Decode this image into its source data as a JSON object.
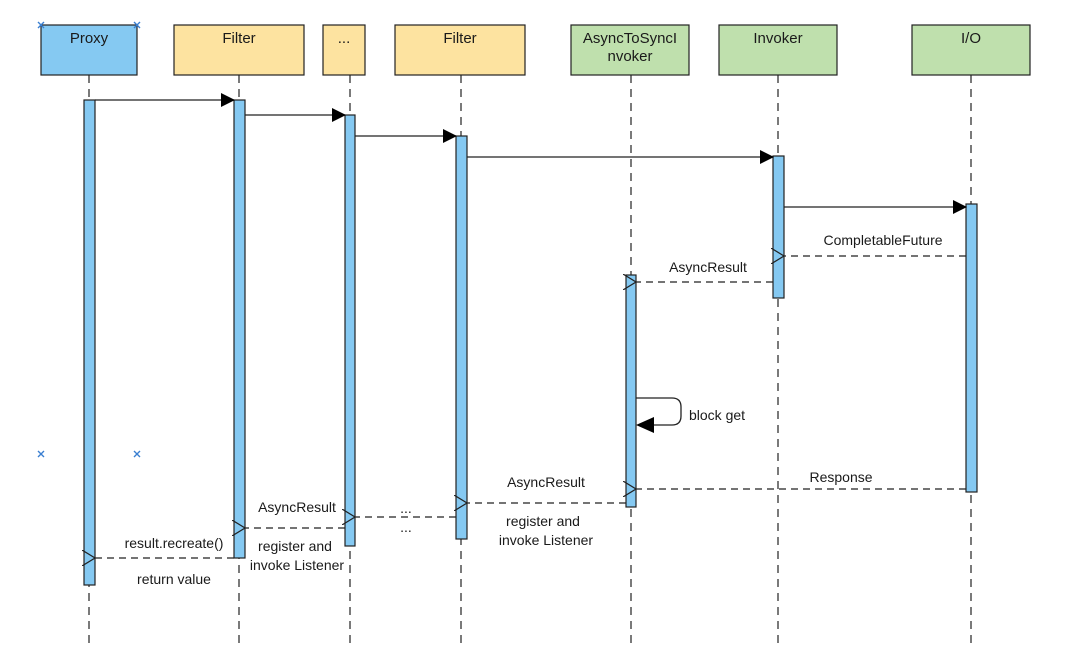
{
  "diagram": {
    "type": "sequence",
    "colors": {
      "proxy": "#85c9f2",
      "filter": "#fde3a0",
      "invoker": "#bfe0ad",
      "activation": "#85c9f2",
      "stroke": "#222222",
      "marker": "#3a7fd1"
    },
    "participants": [
      {
        "id": "proxy",
        "label": "Proxy",
        "kind": "proxy"
      },
      {
        "id": "filter1",
        "label": "Filter",
        "kind": "filter"
      },
      {
        "id": "ellipsis",
        "label": "...",
        "kind": "filter"
      },
      {
        "id": "filter2",
        "label": "Filter",
        "kind": "filter"
      },
      {
        "id": "async",
        "label_lines": [
          "AsyncToSyncI",
          "nvoker"
        ],
        "kind": "invoker"
      },
      {
        "id": "invoker",
        "label": "Invoker",
        "kind": "invoker"
      },
      {
        "id": "io",
        "label": "I/O",
        "kind": "invoker"
      }
    ],
    "messages": [
      {
        "from": "proxy",
        "to": "filter1",
        "style": "sync",
        "label": ""
      },
      {
        "from": "filter1",
        "to": "ellipsis",
        "style": "sync",
        "label": ""
      },
      {
        "from": "ellipsis",
        "to": "filter2",
        "style": "sync",
        "label": ""
      },
      {
        "from": "filter2",
        "to": "invoker",
        "style": "sync",
        "label": ""
      },
      {
        "from": "invoker",
        "to": "io",
        "style": "sync",
        "label": ""
      },
      {
        "from": "io",
        "to": "invoker",
        "style": "return",
        "label": "CompletableFuture"
      },
      {
        "from": "invoker",
        "to": "async",
        "style": "return",
        "label": "AsyncResult"
      },
      {
        "from": "async",
        "to": "async",
        "style": "self",
        "label": "block get"
      },
      {
        "from": "io",
        "to": "async",
        "style": "return",
        "label": "Response"
      },
      {
        "from": "async",
        "to": "filter2",
        "style": "return",
        "label": "AsyncResult",
        "sublabel_lines": [
          "register and",
          "invoke Listener"
        ]
      },
      {
        "from": "filter2",
        "to": "ellipsis",
        "style": "return",
        "label": "...",
        "sublabel": "..."
      },
      {
        "from": "ellipsis",
        "to": "filter1",
        "style": "return",
        "label": "AsyncResult",
        "sublabel_lines": [
          "register and",
          "invoke Listener"
        ]
      },
      {
        "from": "filter1",
        "to": "proxy",
        "style": "return",
        "label": "result.recreate()",
        "sublabel": "return value"
      }
    ]
  }
}
